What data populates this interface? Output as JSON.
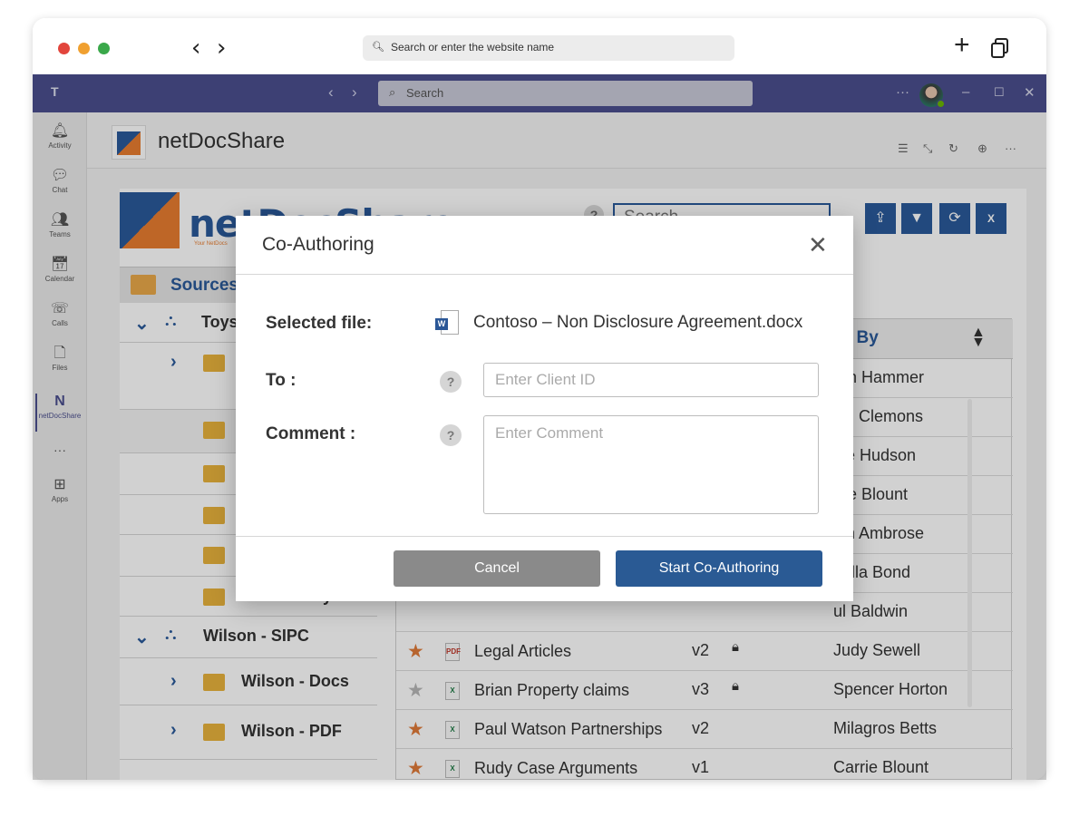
{
  "browser": {
    "address_placeholder": "Search or enter the website name"
  },
  "teams": {
    "search_placeholder": "Search",
    "rail": [
      {
        "label": "Activity",
        "icon": "bell-icon"
      },
      {
        "label": "Chat",
        "icon": "chat-icon"
      },
      {
        "label": "Teams",
        "icon": "teams-icon"
      },
      {
        "label": "Calendar",
        "icon": "calendar-icon"
      },
      {
        "label": "Calls",
        "icon": "phone-icon"
      },
      {
        "label": "Files",
        "icon": "file-icon"
      },
      {
        "label": "netDocShare",
        "icon": "netdocshare-icon"
      },
      {
        "label": "Apps",
        "icon": "apps-icon"
      }
    ]
  },
  "app": {
    "title": "netDocShare",
    "logo_text": "netDocShare",
    "logo_tagline": "Your NetDocs",
    "search_placeholder": "Search"
  },
  "sources": {
    "label": "Sources",
    "rows": [
      {
        "label": "Toys"
      },
      {
        "label": ""
      },
      {
        "label": ""
      },
      {
        "label": ""
      },
      {
        "label": ""
      },
      {
        "label": ""
      },
      {
        "label": "Auston hayden"
      },
      {
        "label": "Wilson - SIPC"
      },
      {
        "label": "Wilson - Docs"
      },
      {
        "label": "Wilson - PDF"
      }
    ]
  },
  "grid": {
    "modified_by_header": "odified By",
    "rows": [
      {
        "name": "",
        "version": "",
        "modified_by": "ren Hammer"
      },
      {
        "name": "",
        "version": "",
        "modified_by": "vid Clemons"
      },
      {
        "name": "",
        "version": "",
        "modified_by": "ine Hudson"
      },
      {
        "name": "",
        "version": "",
        "modified_by": "rrie Blount"
      },
      {
        "name": "",
        "version": "",
        "modified_by": "lan Ambrose"
      },
      {
        "name": "",
        "version": "",
        "modified_by": "riella Bond"
      },
      {
        "name": "",
        "version": "",
        "modified_by": "ul Baldwin"
      },
      {
        "name": "Legal Articles",
        "version": "v2",
        "modified_by": "Judy Sewell",
        "starred": true,
        "type": "pdf",
        "locked": true
      },
      {
        "name": "Brian Property claims",
        "version": "v3",
        "modified_by": "Spencer Horton",
        "starred": false,
        "type": "xlsx",
        "locked": true
      },
      {
        "name": "Paul Watson Partnerships",
        "version": "v2",
        "modified_by": "Milagros Betts",
        "starred": true,
        "type": "xlsx",
        "locked": false
      },
      {
        "name": "Rudy Case Arguments",
        "version": "v1",
        "modified_by": "Carrie Blount",
        "starred": true,
        "type": "xlsx",
        "locked": false
      }
    ]
  },
  "dialog": {
    "title": "Co-Authoring",
    "selected_file_label": "Selected file:",
    "selected_file": "Contoso – Non Disclosure Agreement.docx",
    "to_label": "To :",
    "to_placeholder": "Enter Client ID",
    "comment_label": "Comment :",
    "comment_placeholder": "Enter Comment",
    "cancel_label": "Cancel",
    "start_label": "Start Co-Authoring"
  },
  "colors": {
    "teams_bar": "#4b4f8e",
    "brand_blue": "#2a5a9a",
    "star_orange": "#e07b39",
    "folder_yellow": "#e8b33c"
  }
}
